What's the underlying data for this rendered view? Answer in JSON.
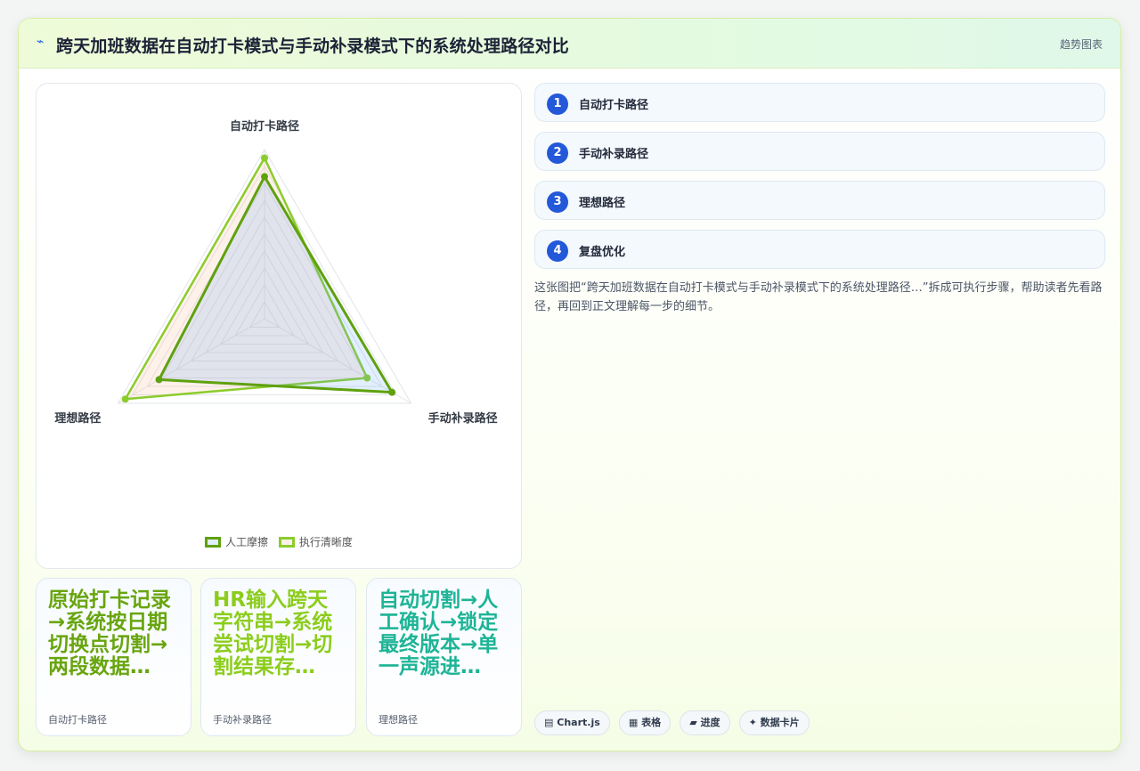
{
  "header": {
    "icon": "⌁",
    "title": "跨天加班数据在自动打卡模式与手动补录模式下的系统处理路径对比",
    "tag": "趋势图表"
  },
  "chart_data": {
    "type": "radar",
    "axes": [
      "自动打卡路径",
      "手动补录路径",
      "理想路径"
    ],
    "max": 100,
    "levels": 10,
    "series": [
      {
        "name": "人工摩擦",
        "values": [
          84,
          87,
          72
        ],
        "color": "#5fa10f",
        "fill": "rgba(96,165,250,0.18)"
      },
      {
        "name": "执行清晰度",
        "values": [
          95,
          70,
          95
        ],
        "color": "#8bcc2c",
        "fill": "rgba(251,191,160,0.22)"
      }
    ],
    "legend_position": "bottom"
  },
  "minis": [
    {
      "text": "原始打卡记录→系统按日期切换点切割→两段数据…",
      "caption": "自动打卡路径",
      "color": "#68a50e"
    },
    {
      "text": "HR输入跨天字符串→系统尝试切割→切割结果存…",
      "caption": "手动补录路径",
      "color": "#8ccd1c"
    },
    {
      "text": "自动切割→人工确认→锁定最终版本→单一声源进…",
      "caption": "理想路径",
      "color": "#1eb496"
    }
  ],
  "steps": [
    {
      "num": "1",
      "label": "自动打卡路径"
    },
    {
      "num": "2",
      "label": "手动补录路径"
    },
    {
      "num": "3",
      "label": "理想路径"
    },
    {
      "num": "4",
      "label": "复盘优化"
    }
  ],
  "description": "这张图把“跨天加班数据在自动打卡模式与手动补录模式下的系统处理路径…”拆成可执行步骤，帮助读者先看路径，再回到正文理解每一步的细节。",
  "chips": [
    {
      "icon": "▤",
      "label": "Chart.js"
    },
    {
      "icon": "▦",
      "label": "表格"
    },
    {
      "icon": "▰",
      "label": "进度"
    },
    {
      "icon": "✦",
      "label": "数据卡片"
    }
  ]
}
